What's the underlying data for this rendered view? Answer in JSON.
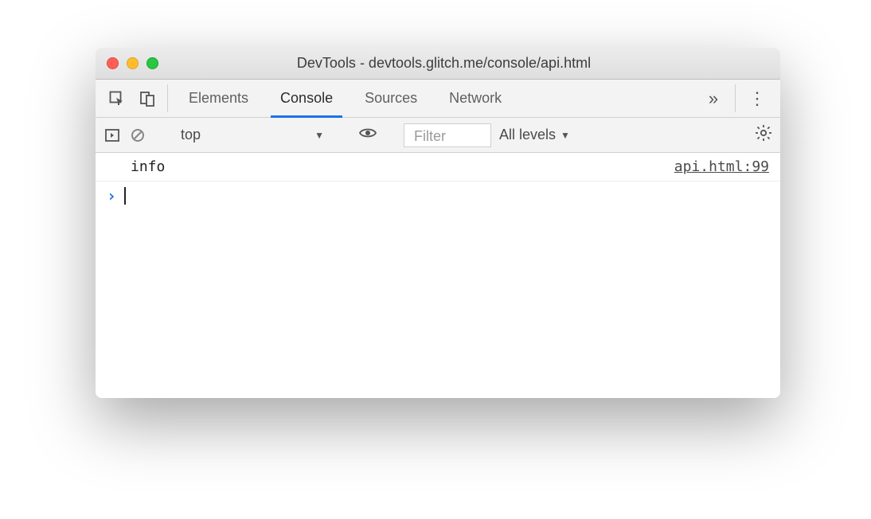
{
  "window": {
    "title": "DevTools - devtools.glitch.me/console/api.html"
  },
  "tabs": {
    "items": [
      "Elements",
      "Console",
      "Sources",
      "Network"
    ],
    "more": "»",
    "activeIndex": 1
  },
  "toolbar": {
    "context": "top",
    "filter_placeholder": "Filter",
    "levels_label": "All levels"
  },
  "log": {
    "message": "info",
    "source": "api.html:99"
  },
  "prompt": {
    "symbol": "›"
  }
}
